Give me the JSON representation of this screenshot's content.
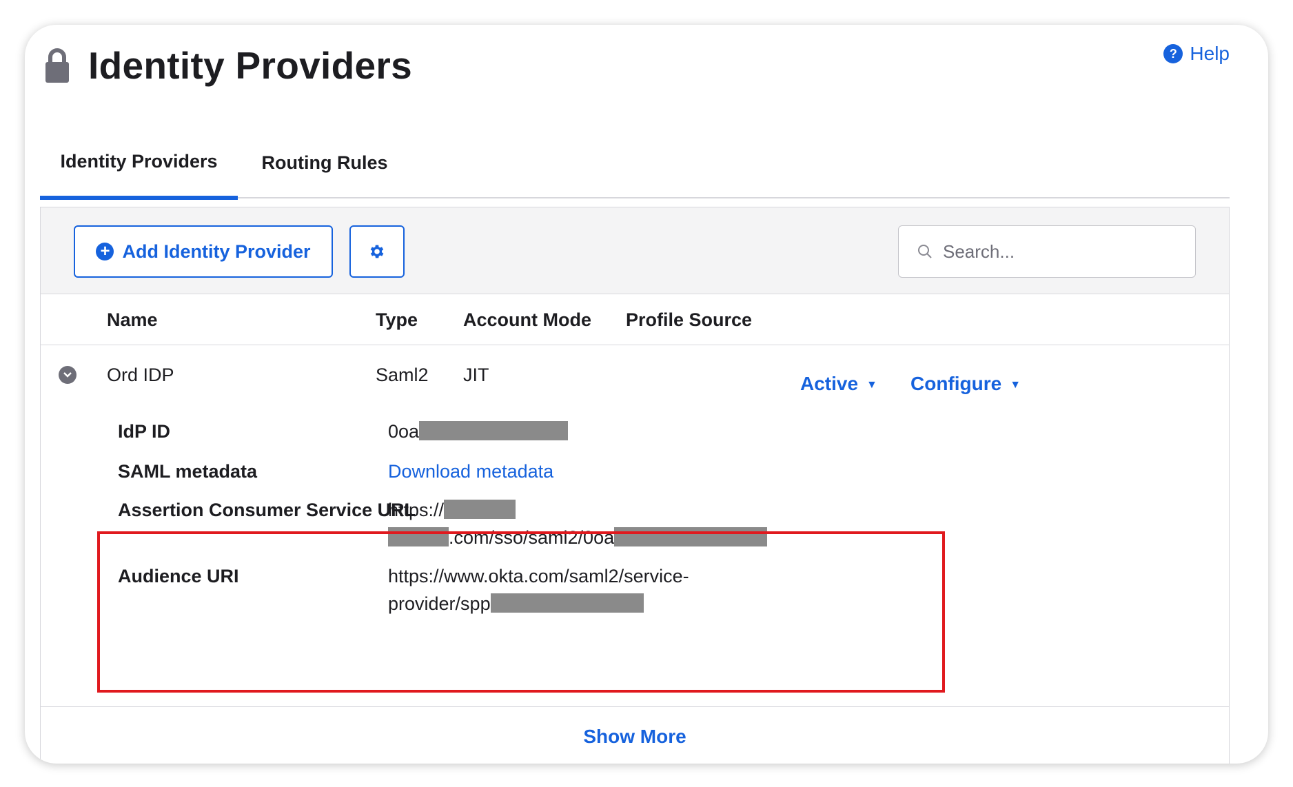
{
  "header": {
    "title": "Identity Providers",
    "help_label": "Help"
  },
  "tabs": [
    {
      "label": "Identity Providers",
      "active": true
    },
    {
      "label": "Routing Rules",
      "active": false
    }
  ],
  "toolbar": {
    "add_label": "Add Identity Provider",
    "search_placeholder": "Search..."
  },
  "table": {
    "columns": [
      "Name",
      "Type",
      "Account Mode",
      "Profile Source"
    ],
    "row": {
      "name": "Ord IDP",
      "type": "Saml2",
      "account_mode": "JIT",
      "status": "Active",
      "configure": "Configure"
    }
  },
  "details": {
    "idp_id_label": "IdP ID",
    "idp_id_prefix": "0oa",
    "saml_label": "SAML metadata",
    "saml_link": "Download metadata",
    "acs_label": "Assertion Consumer Service URL",
    "acs_line1_prefix": "https://",
    "acs_line2_mid": ".com/sso/saml2/0oa",
    "audience_label": "Audience URI",
    "audience_line1": "https://www.okta.com/saml2/service-",
    "audience_line2_prefix": "provider/spp"
  },
  "footer": {
    "show_more": "Show More"
  },
  "colors": {
    "accent": "#1662dd",
    "highlight": "#e0191e",
    "redaction": "#8a8a8a"
  }
}
